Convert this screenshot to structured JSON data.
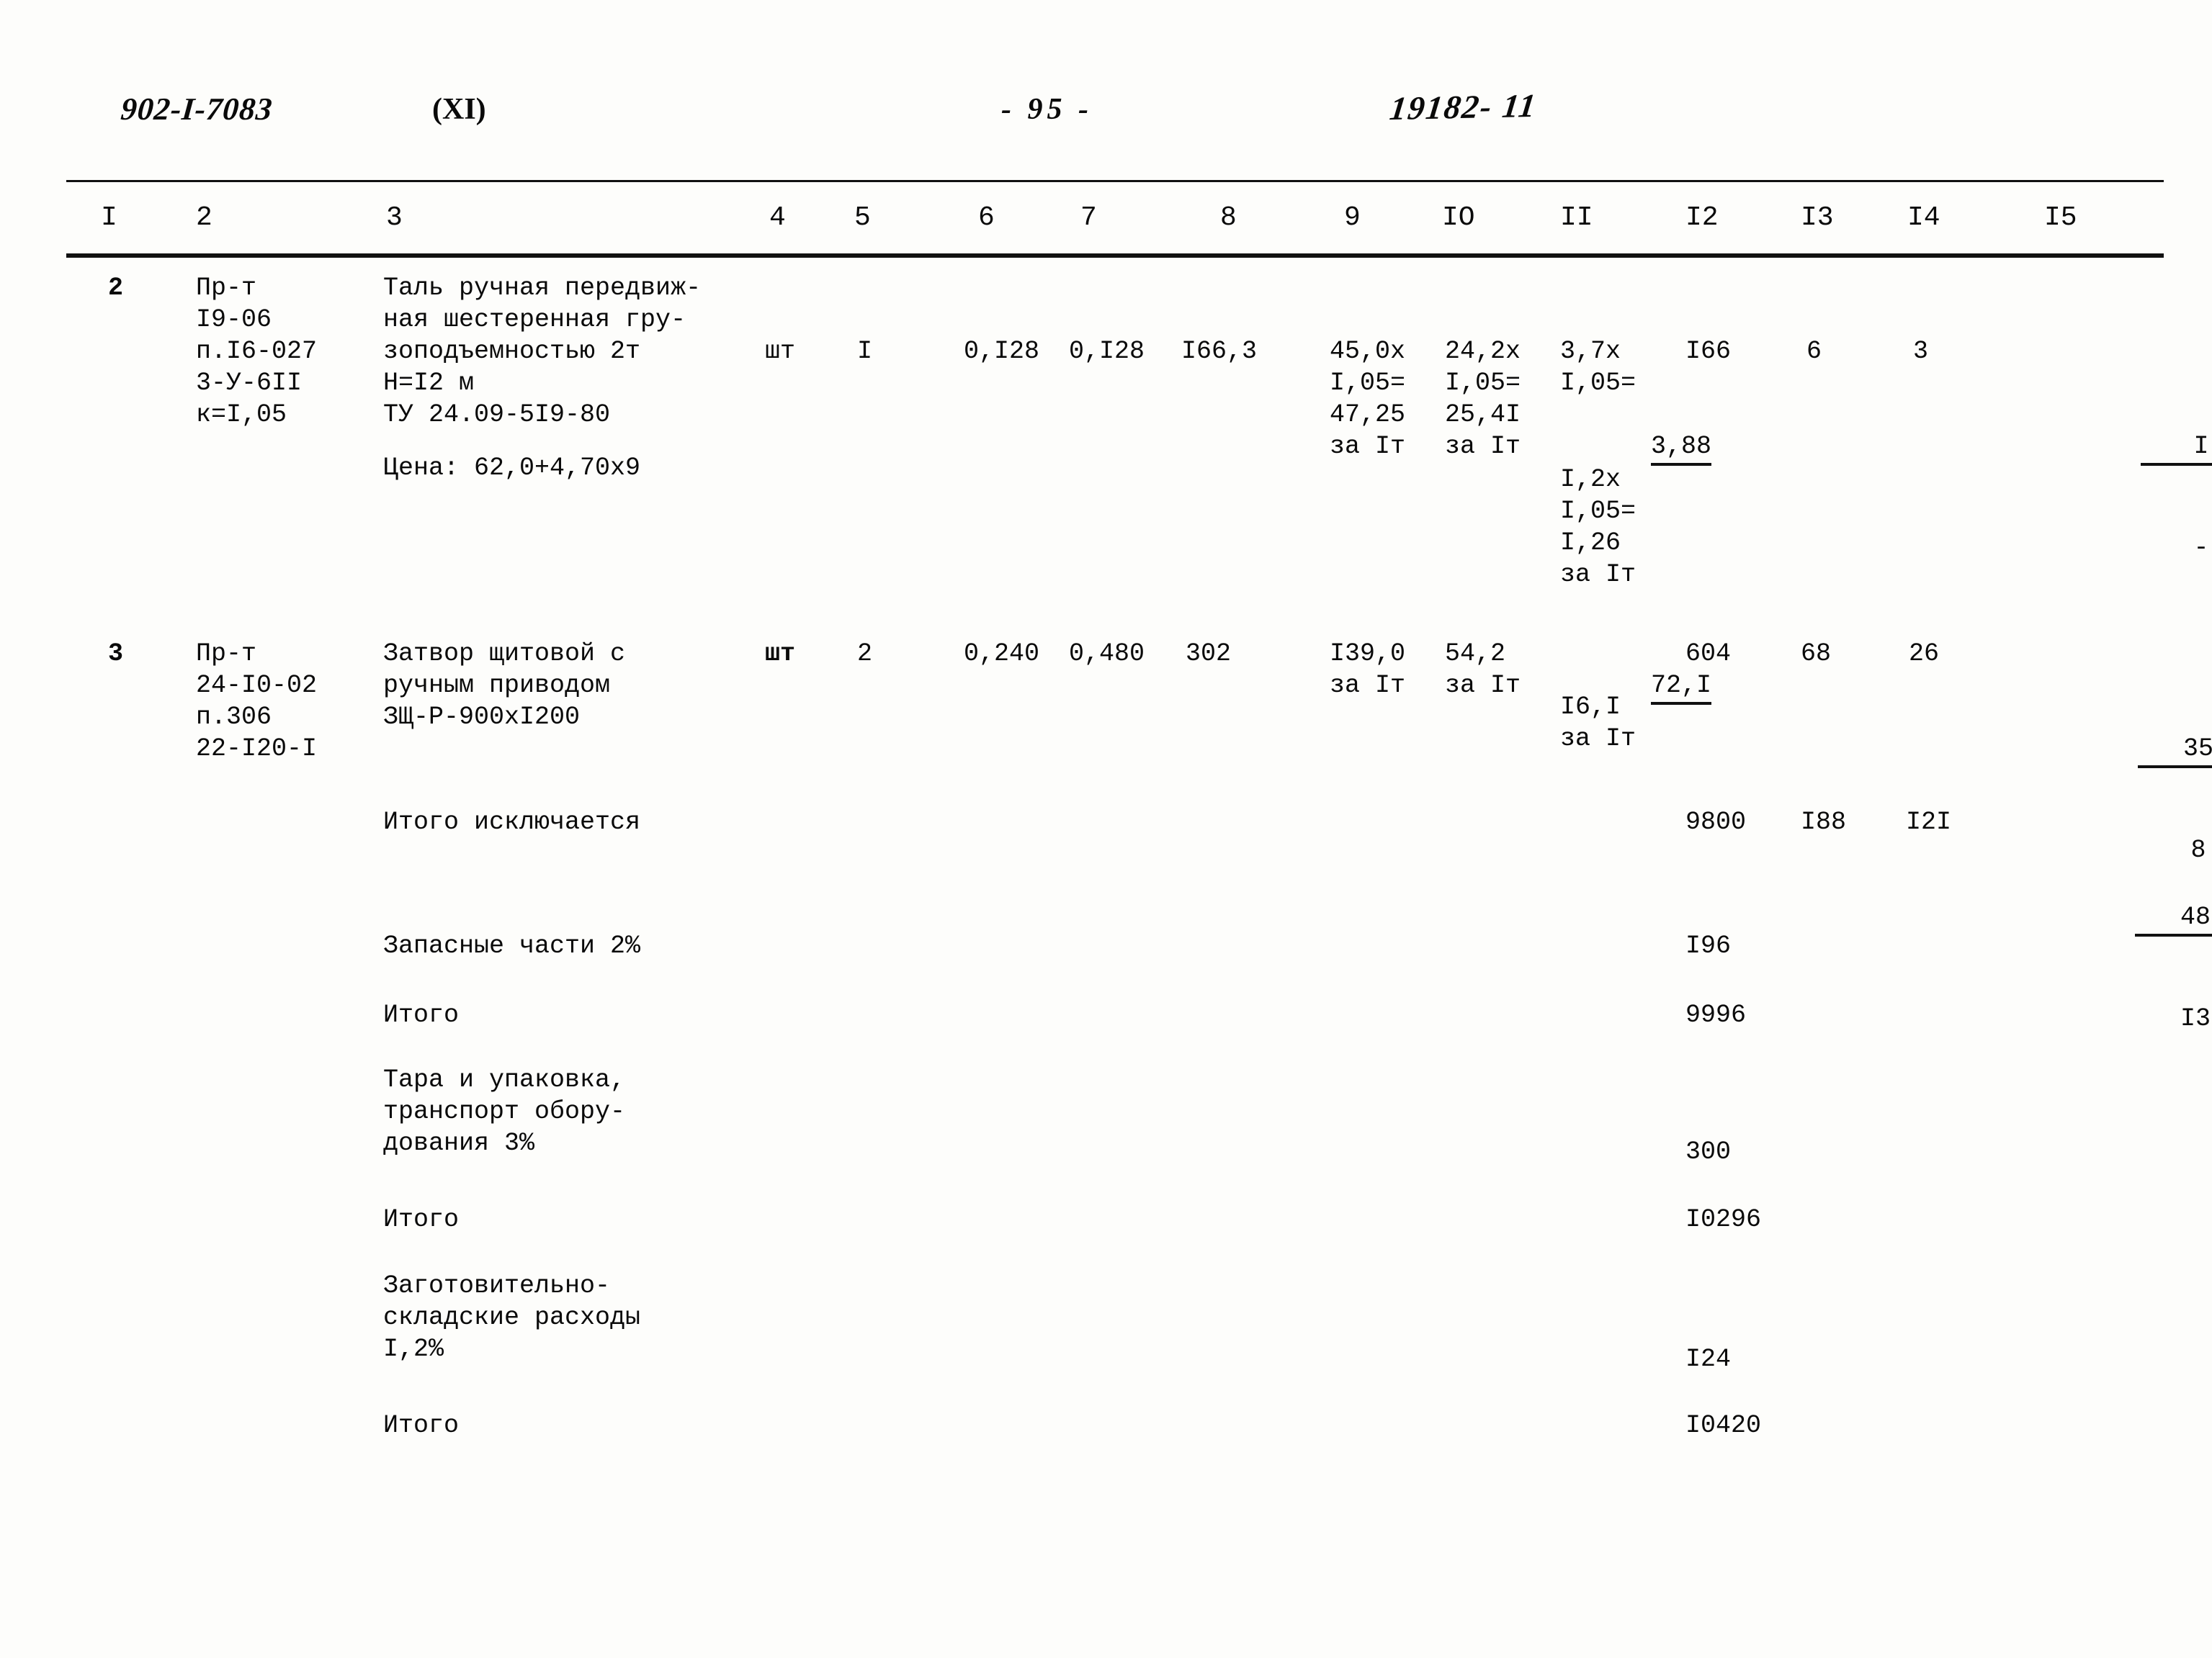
{
  "header": {
    "doc_number": "902-I-7083",
    "volume": "(XI)",
    "page_marker": "-  95  -",
    "reference": "19182- 11"
  },
  "table": {
    "column_headers": [
      "I",
      "2",
      "3",
      "4",
      "5",
      "6",
      "7",
      "8",
      "9",
      "IO",
      "II",
      "I2",
      "I3",
      "I4",
      "I5"
    ],
    "rows": [
      {
        "num": "2",
        "code": "Пр-т\nI9-06\nп.I6-027\n3-У-6II\nк=I,05",
        "name": "Таль ручная передвиж-\nная шестеренная гру-\nзоподъемностью 2т\nH=I2 м\nТУ 24.09-5I9-80",
        "price_note": "Цена: 62,0+4,70х9",
        "unit": "шт",
        "qty": "I",
        "c6": "0,I28",
        "c7": "0,I28",
        "c8": "I66,3",
        "c9": "45,0х\nI,05=\n47,25\nза Iт",
        "c10": "24,2х\nI,05=\n25,4I\nза Iт",
        "c11_top": "3,7х\nI,05=",
        "c11_underlined": "3,88",
        "c11_bottom": "I,2х\nI,05=\nI,26\nза Iт",
        "c12": "I66",
        "c13": "6",
        "c14": "3",
        "c15_top": "I",
        "c15_bot": "-"
      },
      {
        "num": "3",
        "code": "Пр-т\n24-I0-02\nп.306\n22-I20-I",
        "name": "Затвор щитовой с\nручным приводом\nЗЩ-Р-900хI200",
        "price_note": "",
        "unit": "шт",
        "qty": "2",
        "c6": "0,240",
        "c7": "0,480",
        "c8": "302",
        "c9": "I39,0\nза Iт",
        "c10": "54,2\nза Iт",
        "c11_top": "",
        "c11_underlined": "72,I",
        "c11_bottom": "I6,I\nза Iт",
        "c12": "604",
        "c13": "68",
        "c14": "26",
        "c15_top": "35",
        "c15_bot": "8"
      }
    ],
    "summary": [
      {
        "label": "Итого исключается",
        "c12": "9800",
        "c13": "I88",
        "c14": "I2I",
        "c15_top": "48",
        "c15_bot": "I3"
      },
      {
        "label": "Запасные части 2%",
        "c12": "I96",
        "c13": "",
        "c14": "",
        "c15_top": "",
        "c15_bot": ""
      },
      {
        "label": "Итого",
        "c12": "9996",
        "c13": "",
        "c14": "",
        "c15_top": "",
        "c15_bot": ""
      },
      {
        "label": "Тара и упаковка,\nтранспорт обору-\nдования 3%",
        "c12": "300",
        "c13": "",
        "c14": "",
        "c15_top": "",
        "c15_bot": ""
      },
      {
        "label": "Итого",
        "c12": "I0296",
        "c13": "",
        "c14": "",
        "c15_top": "",
        "c15_bot": ""
      },
      {
        "label": "Заготовительно-\nскладские расходы\nI,2%",
        "c12": "I24",
        "c13": "",
        "c14": "",
        "c15_top": "",
        "c15_bot": ""
      },
      {
        "label": "Итого",
        "c12": "I0420",
        "c13": "",
        "c14": "",
        "c15_top": "",
        "c15_bot": ""
      }
    ]
  }
}
